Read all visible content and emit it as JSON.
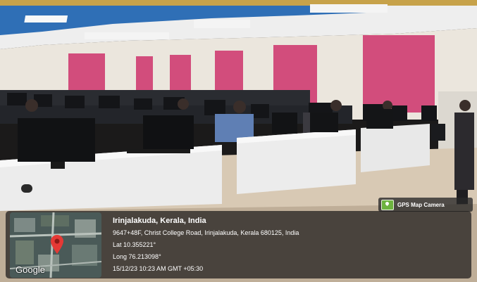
{
  "gps_badge": {
    "label": "GPS Map Camera",
    "icon": "map-pin-logo"
  },
  "map_thumbnail": {
    "brand": "Google",
    "pin_color": "#e53935"
  },
  "location": {
    "place": "Irinjalakuda, Kerala, India",
    "address": "9647+48F, Christ College Road, Irinjalakuda, Kerala 680125, India",
    "lat": "Lat 10.355221°",
    "long": "Long 76.213098°",
    "timestamp": "15/12/23 10:23 AM GMT +05:30"
  },
  "colors": {
    "wall_accent": "#d24d7c",
    "ceiling_blue": "#2b6fb8",
    "desk": "#ececec"
  }
}
